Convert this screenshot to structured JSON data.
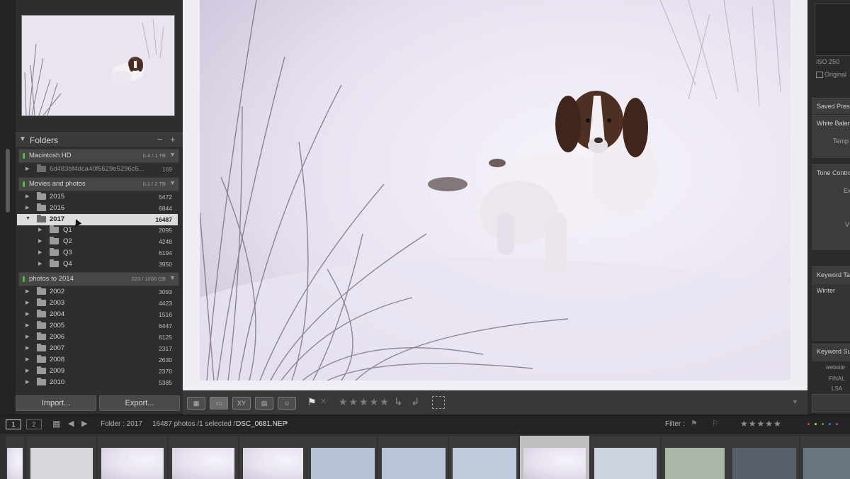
{
  "folders_panel": {
    "title": "Folders",
    "minus": "−",
    "plus": "+",
    "volumes": [
      {
        "name": "Macintosh HD",
        "capacity": "0.4 / 1 TB"
      },
      {
        "name": "Movies and photos",
        "capacity": "0.1 / 2 TB"
      },
      {
        "name": "photos to 2014",
        "capacity": "223 / 1000 GB"
      }
    ],
    "mac_folder": {
      "name": "6d483bf4dca40f5629e5296c5...",
      "count": "169"
    },
    "movies_folders": [
      {
        "name": "2015",
        "count": "5472"
      },
      {
        "name": "2016",
        "count": "6844"
      },
      {
        "name": "2017",
        "count": "16487"
      }
    ],
    "subfolders_2017": [
      {
        "name": "Q1",
        "count": "2095"
      },
      {
        "name": "Q2",
        "count": "4248"
      },
      {
        "name": "Q3",
        "count": "6194"
      },
      {
        "name": "Q4",
        "count": "3950"
      }
    ],
    "archive_folders": [
      {
        "name": "2002",
        "count": "3093"
      },
      {
        "name": "2003",
        "count": "4423"
      },
      {
        "name": "2004",
        "count": "1516"
      },
      {
        "name": "2005",
        "count": "6447"
      },
      {
        "name": "2006",
        "count": "6125"
      },
      {
        "name": "2007",
        "count": "2317"
      },
      {
        "name": "2008",
        "count": "2630"
      },
      {
        "name": "2009",
        "count": "2370"
      },
      {
        "name": "2010",
        "count": "5385"
      }
    ]
  },
  "buttons": {
    "import": "Import...",
    "export": "Export..."
  },
  "right_panel": {
    "iso": "ISO 250",
    "original": "Original",
    "saved_presets": "Saved Prese",
    "white_balance": "White Balar",
    "temp": "Temp",
    "tone_control": "Tone Contro",
    "exposure": "Ex",
    "vibrance": "V",
    "keyword_tags": "Keyword Ta",
    "keyword_value": "Winter",
    "keyword_suggestions": "Keyword Su",
    "suggestions": [
      "website",
      "FINAL",
      "LSA"
    ]
  },
  "toolbar": {
    "grid_icon": "grid-view-icon",
    "loupe_icon": "loupe-view-icon",
    "compare_label": "XY",
    "stars": "★★★★★"
  },
  "status_bar": {
    "screen1": "1",
    "screen2": "2",
    "folder": "Folder : 2017",
    "count": "16487 photos /1 selected /",
    "filename": "DSC_0681.NEF",
    "filter_label": "Filter :",
    "filter_stars": "★★★★★"
  },
  "colors": {
    "selection": "#dcdcdc",
    "panel": "#2e2e2e",
    "accent_green": "#5fb14e",
    "photo_bg": "#f1edf5"
  }
}
